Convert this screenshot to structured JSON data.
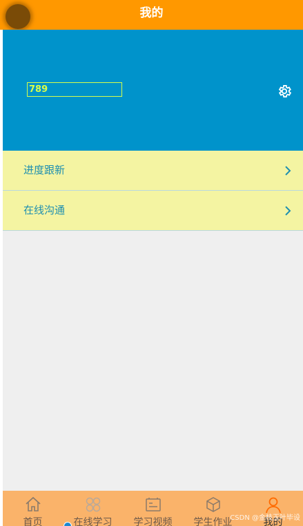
{
  "header": {
    "title": "我的"
  },
  "profile": {
    "username": "789"
  },
  "menu": {
    "items": [
      {
        "label": "进度跟新"
      },
      {
        "label": "在线沟通"
      }
    ]
  },
  "nav": {
    "items": [
      {
        "label": "首页",
        "icon": "home-icon"
      },
      {
        "label": "在线学习",
        "icon": "apps-icon"
      },
      {
        "label": "学习视频",
        "icon": "video-icon"
      },
      {
        "label": "学生作业",
        "icon": "homework-icon"
      },
      {
        "label": "我的",
        "icon": "user-icon",
        "active": true
      }
    ]
  },
  "watermark": "CSDN @金枝玉叶毕设",
  "colors": {
    "header": "#ff9800",
    "profile": "#0093cb",
    "menu": "#f4f4a2",
    "nav": "#fab36a",
    "active": "#ff6a00"
  }
}
